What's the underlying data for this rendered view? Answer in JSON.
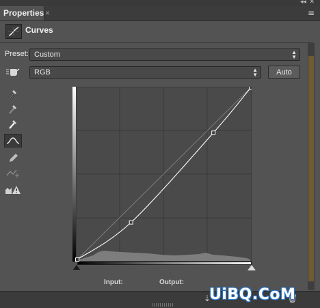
{
  "window": {
    "collapse_glyph": "◂◂",
    "close_glyph": "✕"
  },
  "tab": {
    "label": "Properties",
    "close": "×",
    "menu_glyph": "≡"
  },
  "header": {
    "title": "Curves",
    "icon": "curves-adjustment-icon"
  },
  "preset": {
    "label": "Preset:",
    "value": "Custom"
  },
  "channel": {
    "value": "RGB"
  },
  "auto_button": {
    "label": "Auto"
  },
  "tools": [
    "targeted-adjustment-hand-icon",
    "black-point-eyedropper-icon",
    "gray-point-eyedropper-icon",
    "white-point-eyedropper-icon",
    "edit-points-curve-icon",
    "pencil-draw-icon",
    "smooth-curve-icon",
    "clipping-warning-icon"
  ],
  "curve": {
    "input_label": "Input:",
    "output_label": "Output:",
    "points": [
      [
        0,
        0
      ],
      [
        79,
        55
      ],
      [
        200,
        188
      ],
      [
        255,
        255
      ]
    ]
  },
  "watermark": {
    "text": "UiBQ.CoM"
  },
  "colors": {
    "panel": "#535353",
    "graph": "#4a4a4a",
    "curve": "#ffffff",
    "histogram": "#7d7d7d"
  }
}
